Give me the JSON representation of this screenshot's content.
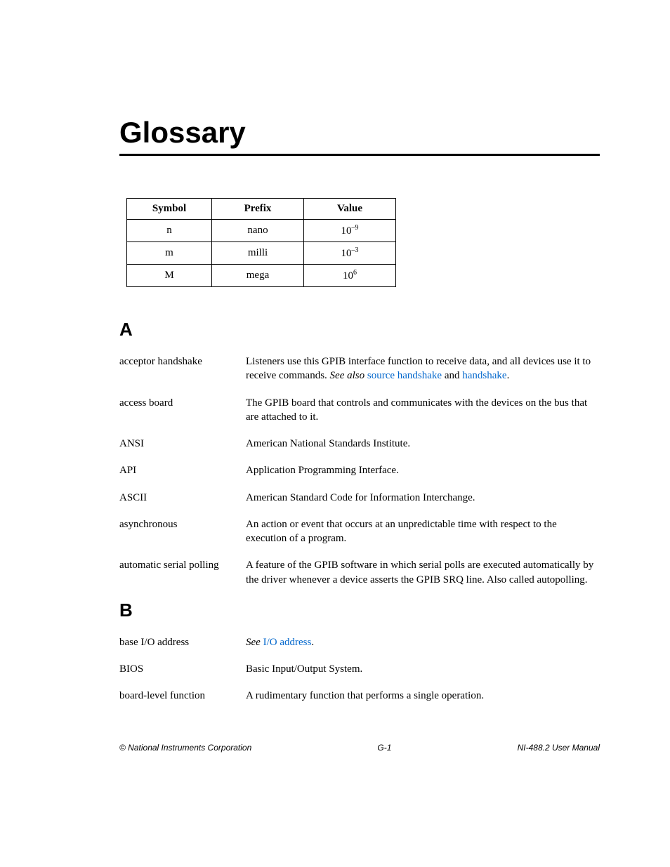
{
  "title": "Glossary",
  "table": {
    "headers": [
      "Symbol",
      "Prefix",
      "Value"
    ],
    "rows": [
      {
        "symbol": "n",
        "prefix": "nano",
        "base": "10",
        "exp": "–9"
      },
      {
        "symbol": "m",
        "prefix": "milli",
        "base": "10",
        "exp": "–3"
      },
      {
        "symbol": "M",
        "prefix": "mega",
        "base": "10",
        "exp": "6"
      }
    ]
  },
  "sections": {
    "A": {
      "letter": "A",
      "entries": [
        {
          "term": "acceptor handshake",
          "def_pre": "Listeners use this GPIB interface function to receive data, and all devices use it to receive commands. ",
          "see_also_label": "See also",
          "link1": "source handshake",
          "mid": " and ",
          "link2": "handshake",
          "suffix": "."
        },
        {
          "term": "access board",
          "def": "The GPIB board that controls and communicates with the devices on the bus that are attached to it."
        },
        {
          "term": "ANSI",
          "def": "American National Standards Institute."
        },
        {
          "term": "API",
          "def": "Application Programming Interface."
        },
        {
          "term": "ASCII",
          "def": "American Standard Code for Information Interchange."
        },
        {
          "term": "asynchronous",
          "def": "An action or event that occurs at an unpredictable time with respect to the execution of a program."
        },
        {
          "term": "automatic serial polling",
          "def": "A feature of the GPIB software in which serial polls are executed automatically by the driver whenever a device asserts the GPIB SRQ line. Also called autopolling."
        }
      ]
    },
    "B": {
      "letter": "B",
      "entries": [
        {
          "term": "base I/O address",
          "see_label": "See",
          "space": " ",
          "link1": "I/O address",
          "suffix": "."
        },
        {
          "term": "BIOS",
          "def": "Basic Input/Output System."
        },
        {
          "term": "board-level function",
          "def": "A rudimentary function that performs a single operation."
        }
      ]
    }
  },
  "footer": {
    "left": "© National Instruments Corporation",
    "center": "G-1",
    "right": "NI-488.2 User Manual"
  }
}
